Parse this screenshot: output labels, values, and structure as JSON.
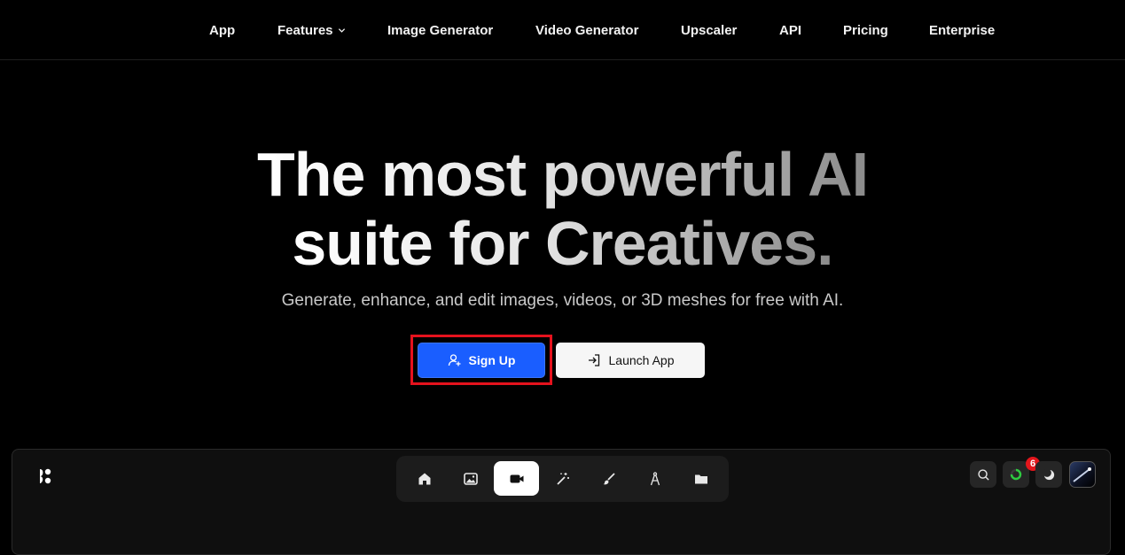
{
  "nav": {
    "items": [
      {
        "label": "App"
      },
      {
        "label": "Features",
        "has_dropdown": true
      },
      {
        "label": "Image Generator"
      },
      {
        "label": "Video Generator"
      },
      {
        "label": "Upscaler"
      },
      {
        "label": "API"
      },
      {
        "label": "Pricing"
      },
      {
        "label": "Enterprise"
      }
    ]
  },
  "hero": {
    "headline_line1": "The most powerful AI",
    "headline_line2": "suite for Creatives.",
    "subheadline": "Generate, enhance, and edit images, videos, or 3D meshes for free with AI.",
    "signup_label": "Sign Up",
    "launch_label": "Launch App"
  },
  "app_preview": {
    "toolbar_items": [
      "home-icon",
      "image-icon",
      "video-camera-icon",
      "magic-wand-icon",
      "brush-icon",
      "compass-icon",
      "folder-icon"
    ],
    "active_tool": "video-camera-icon",
    "notification_count": "6"
  },
  "colors": {
    "primary": "#1a5eff",
    "highlight_border": "#e5121d",
    "badge": "#e3161c",
    "background": "#000000"
  }
}
